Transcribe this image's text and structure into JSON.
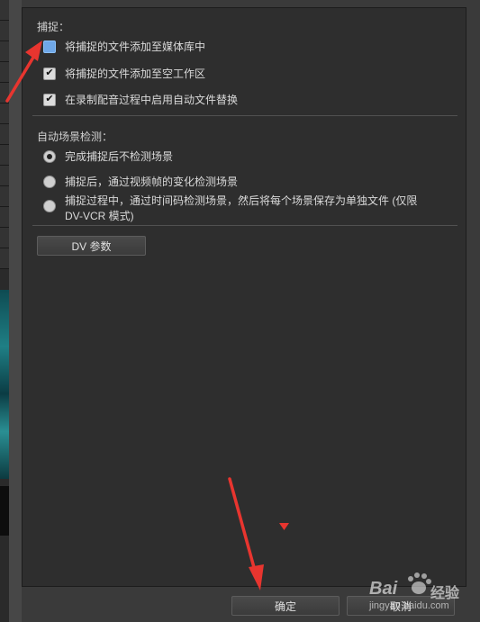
{
  "capture_section": {
    "title": "捕捉：",
    "options": [
      {
        "label": "将捕捉的文件添加至媒体库中",
        "checked": false,
        "focused": true
      },
      {
        "label": "将捕捉的文件添加至空工作区",
        "checked": true
      },
      {
        "label": "在录制配音过程中启用自动文件替换",
        "checked": true
      }
    ]
  },
  "scene_section": {
    "title": "自动场景检测：",
    "options": [
      {
        "label": "完成捕捉后不检测场景",
        "selected": true
      },
      {
        "label": "捕捉后，通过视频帧的变化检测场景",
        "selected": false
      },
      {
        "label_line1": "捕捉过程中，通过时间码检测场景，然后将每个场景保存为单独文件 (仅限",
        "label_line2": "DV-VCR 模式)",
        "selected": false
      }
    ]
  },
  "dv_button": "DV 参数",
  "footer": {
    "ok": "确定",
    "cancel": "取消"
  },
  "watermark": {
    "brand": "Bai",
    "brand2": "经验",
    "url": "jingyan.baidu.com"
  },
  "colors": {
    "panel_bg": "#2e2e2e",
    "annotation_red": "#e8352f",
    "focus_blue": "#6fa8e8"
  },
  "icons": [
    "checkmark-icon",
    "radio-dot-icon",
    "red-arrow-annotation",
    "dropdown-triangle-icon",
    "baidu-paw-logo"
  ]
}
